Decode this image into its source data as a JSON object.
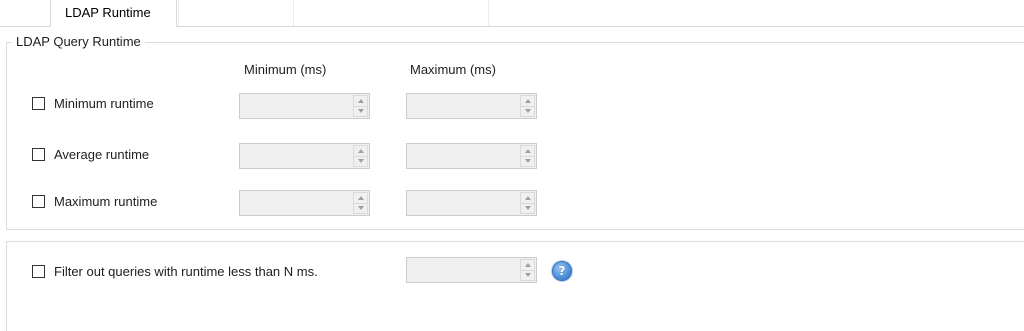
{
  "tabs": [
    {
      "label": "LDAP Runtime",
      "active": true
    }
  ],
  "runtime_group": {
    "title": "LDAP Query Runtime",
    "column_headers": {
      "minimum": "Minimum (ms)",
      "maximum": "Maximum (ms)"
    },
    "rows": [
      {
        "label": "Minimum runtime",
        "checked": false,
        "min_value": "",
        "max_value": ""
      },
      {
        "label": "Average runtime",
        "checked": false,
        "min_value": "",
        "max_value": ""
      },
      {
        "label": "Maximum runtime",
        "checked": false,
        "min_value": "",
        "max_value": ""
      }
    ]
  },
  "filter_group": {
    "label": "Filter out queries with runtime less than N ms.",
    "checked": false,
    "value": "",
    "help_icon": "help-icon",
    "help_glyph": "?"
  },
  "colors": {
    "disabled_field_bg": "#f0f0f0",
    "border": "#cccccc",
    "help_blue": "#4b8fd8"
  }
}
